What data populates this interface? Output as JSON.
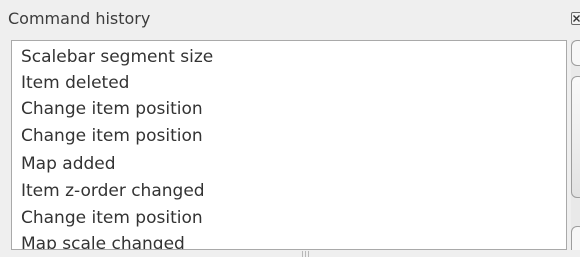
{
  "panel": {
    "title": "Command history",
    "close_icon": "close-icon",
    "history": [
      "Scalebar segment size",
      "Item deleted",
      "Change item position",
      "Change item position",
      "Map added",
      "Item z-order changed",
      "Change item position",
      "Map scale changed"
    ]
  }
}
